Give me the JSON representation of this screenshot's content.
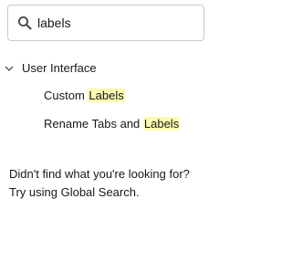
{
  "search": {
    "value": "labels",
    "icon": "search-icon"
  },
  "tree": {
    "group": {
      "label": "User Interface",
      "expanded": true,
      "icon": "chevron-down-icon"
    },
    "items": [
      {
        "prefix": "Custom ",
        "highlight": "Labels",
        "suffix": ""
      },
      {
        "prefix": "Rename Tabs and ",
        "highlight": "Labels",
        "suffix": ""
      }
    ]
  },
  "not_found": {
    "line1": "Didn't find what you're looking for?",
    "line2": "Try using Global Search."
  },
  "colors": {
    "highlight": "#fdfbb0",
    "border": "#c9c9c9",
    "text": "#181818"
  }
}
